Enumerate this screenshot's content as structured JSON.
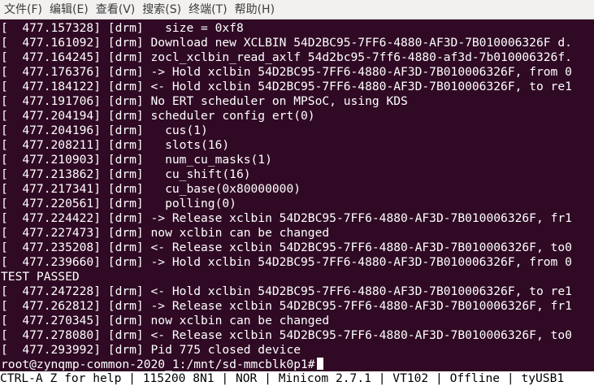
{
  "menubar": {
    "items": [
      "文件(F)",
      "编辑(E)",
      "查看(V)",
      "搜索(S)",
      "终端(T)",
      "帮助(H)"
    ]
  },
  "terminal": {
    "lines": [
      "[  477.157328] [drm]   size = 0xf8",
      "[  477.161092] [drm] Download new XCLBIN 54D2BC95-7FF6-4880-AF3D-7B010006326F d.",
      "[  477.164245] [drm] zocl_xclbin_read_axlf 54d2bc95-7ff6-4880-af3d-7b010006326f.",
      "[  477.176376] [drm] -> Hold xclbin 54D2BC95-7FF6-4880-AF3D-7B010006326F, from 0",
      "[  477.184122] [drm] <- Hold xclbin 54D2BC95-7FF6-4880-AF3D-7B010006326F, to re1",
      "[  477.191706] [drm] No ERT scheduler on MPSoC, using KDS",
      "[  477.204194] [drm] scheduler config ert(0)",
      "[  477.204196] [drm]   cus(1)",
      "[  477.208211] [drm]   slots(16)",
      "[  477.210903] [drm]   num_cu_masks(1)",
      "[  477.213862] [drm]   cu_shift(16)",
      "[  477.217341] [drm]   cu_base(0x80000000)",
      "[  477.220561] [drm]   polling(0)",
      "[  477.224422] [drm] -> Release xclbin 54D2BC95-7FF6-4880-AF3D-7B010006326F, fr1",
      "[  477.227473] [drm] now xclbin can be changed",
      "[  477.235208] [drm] <- Release xclbin 54D2BC95-7FF6-4880-AF3D-7B010006326F, to0",
      "[  477.239660] [drm] -> Hold xclbin 54D2BC95-7FF6-4880-AF3D-7B010006326F, from 0",
      "TEST PASSED",
      "[  477.247228] [drm] <- Hold xclbin 54D2BC95-7FF6-4880-AF3D-7B010006326F, to re1",
      "[  477.262812] [drm] -> Release xclbin 54D2BC95-7FF6-4880-AF3D-7B010006326F, fr1",
      "[  477.270345] [drm] now xclbin can be changed",
      "[  477.278080] [drm] <- Release xclbin 54D2BC95-7FF6-4880-AF3D-7B010006326F, to0",
      "[  477.293992] [drm] Pid 775 closed device"
    ],
    "prompt": "root@zynqmp-common-2020_1:/mnt/sd-mmcblk0p1#"
  },
  "statusbar": {
    "segments": [
      "CTRL-A Z for help",
      "115200 8N1",
      "NOR",
      "Minicom 2.7.1",
      "VT102",
      "Offline",
      "tyUSB1"
    ],
    "separator": " | "
  },
  "colors": {
    "terminal_bg": "#300a24",
    "terminal_fg": "#ffffff",
    "menubar_bg": "#f2f1f0",
    "statusbar_bg": "#ffffff",
    "statusbar_fg": "#000000"
  }
}
